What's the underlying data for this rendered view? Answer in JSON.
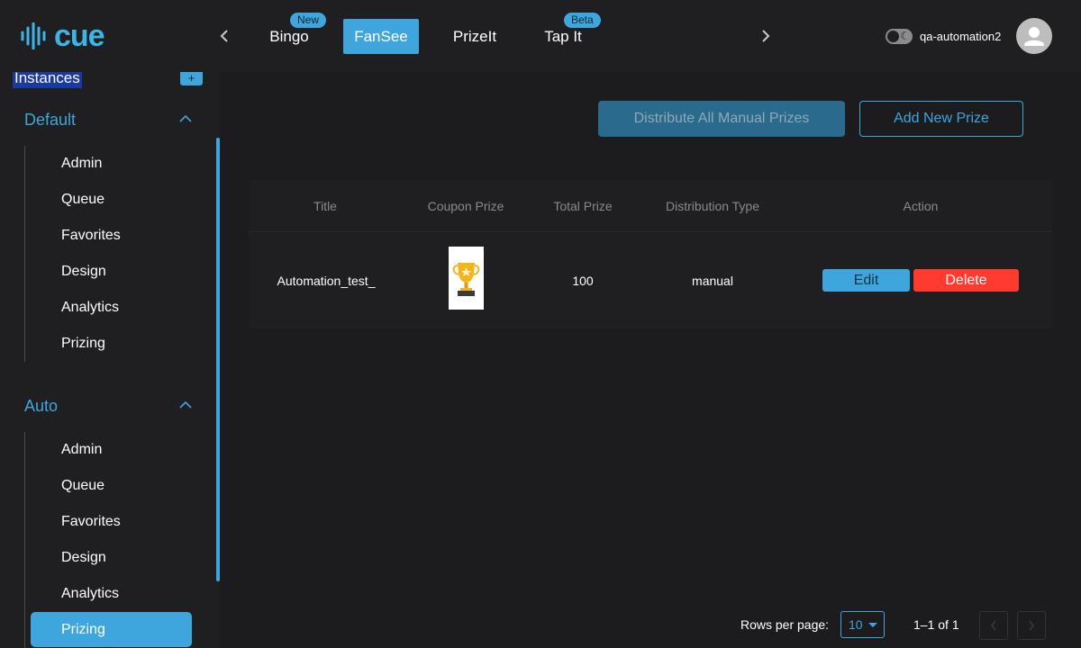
{
  "brand": {
    "name": "cue",
    "accent": "#3fa6dd",
    "danger": "#ff3b30"
  },
  "header": {
    "tabs": [
      {
        "label": "Bingo",
        "badge": "New",
        "active": false
      },
      {
        "label": "FanSee",
        "badge": "",
        "active": true
      },
      {
        "label": "PrizeIt",
        "badge": "",
        "active": false
      },
      {
        "label": "Tap It",
        "badge": "Beta",
        "active": false
      }
    ],
    "prev_icon": "chevron-left-icon",
    "next_icon": "chevron-right-icon",
    "theme_toggle_icon": "moon-icon",
    "username": "qa-automation2",
    "avatar_icon": "user-avatar-icon"
  },
  "sidebar": {
    "instances_label": "Instances",
    "add_label": "+",
    "groups": [
      {
        "title": "Default",
        "items": [
          "Admin",
          "Queue",
          "Favorites",
          "Design",
          "Analytics",
          "Prizing"
        ]
      },
      {
        "title": "Auto",
        "items": [
          "Admin",
          "Queue",
          "Favorites",
          "Design",
          "Analytics",
          "Prizing"
        ],
        "active_item": "Prizing"
      }
    ]
  },
  "main": {
    "distribute_label": "Distribute All Manual Prizes",
    "add_prize_label": "Add New Prize",
    "table": {
      "headers": [
        "Title",
        "Coupon Prize",
        "Total Prize",
        "Distribution Type",
        "Action"
      ],
      "rows": [
        {
          "title": "Automation_test_",
          "coupon_prize_icon": "trophy-icon",
          "total_prize": "100",
          "distribution_type": "manual",
          "edit_label": "Edit",
          "delete_label": "Delete"
        }
      ]
    },
    "pagination": {
      "rows_per_page_label": "Rows per page:",
      "rows_per_page_value": "10",
      "range_text": "1–1 of 1"
    }
  }
}
